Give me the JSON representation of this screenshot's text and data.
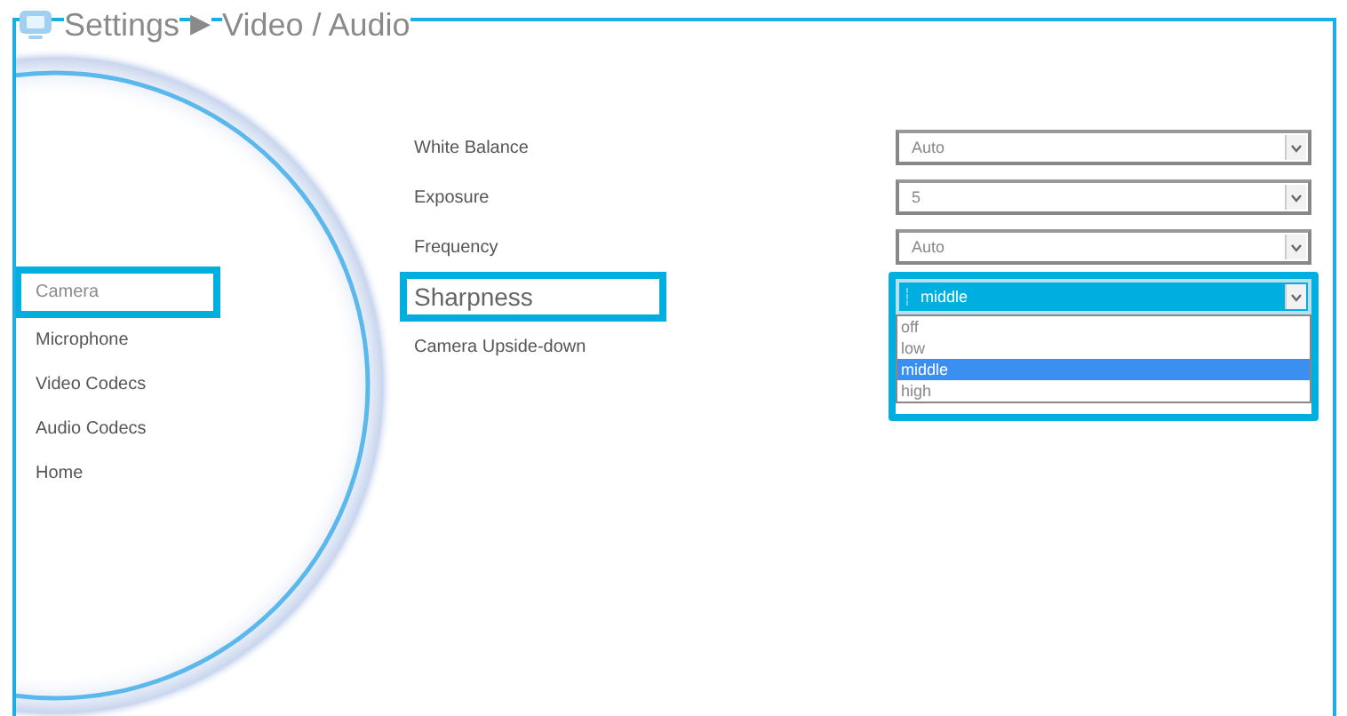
{
  "breadcrumb": {
    "section": "Settings",
    "separator": "▶",
    "page": "Video / Audio"
  },
  "sidebar": {
    "items": [
      {
        "label": "Camera",
        "selected": true
      },
      {
        "label": "Microphone",
        "selected": false
      },
      {
        "label": "Video Codecs",
        "selected": false
      },
      {
        "label": "Audio Codecs",
        "selected": false
      },
      {
        "label": "Home",
        "selected": false
      }
    ]
  },
  "settings": [
    {
      "label": "White Balance",
      "kind": "select",
      "value": "Auto",
      "highlighted": false,
      "expanded": false
    },
    {
      "label": "Exposure",
      "kind": "select",
      "value": "5",
      "highlighted": false,
      "expanded": false
    },
    {
      "label": "Frequency",
      "kind": "select",
      "value": "Auto",
      "highlighted": false,
      "expanded": false
    },
    {
      "label": "Sharpness",
      "kind": "select",
      "value": "middle",
      "highlighted": true,
      "expanded": true,
      "options": [
        {
          "label": "off",
          "selected": false
        },
        {
          "label": "low",
          "selected": false
        },
        {
          "label": "middle",
          "selected": true
        },
        {
          "label": "high",
          "selected": false
        }
      ]
    },
    {
      "label": "Camera Upside-down",
      "kind": "label",
      "highlighted": false
    }
  ]
}
